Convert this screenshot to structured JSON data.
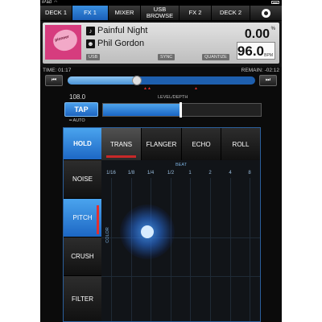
{
  "status": {
    "device": "iPad",
    "wifi_icon": "wifi-icon"
  },
  "tabs": [
    {
      "label": "DECK 1",
      "active": false
    },
    {
      "label": "FX 1",
      "active": true
    },
    {
      "label": "MIXER",
      "active": false
    },
    {
      "label": "USB BROWSE",
      "active": false
    },
    {
      "label": "FX 2",
      "active": false
    },
    {
      "label": "DECK 2",
      "active": false
    }
  ],
  "track": {
    "art_text": "pioneer",
    "title": "Painful Night",
    "artist": "Phil Gordon",
    "source": "USB",
    "sync": "SYNC",
    "quantize": "QUANTIZE",
    "pitch": "0.00",
    "pitch_unit": "%",
    "bpm": "96.0",
    "bpm_unit": "BPM"
  },
  "time": {
    "elapsed": "TIME: 01:17",
    "remain": "REMAIN: -02:12",
    "progress": 0.37
  },
  "level": {
    "label": "LEVEL/DEPTH",
    "bpm": "108.0",
    "value": 0.49
  },
  "tap": {
    "label": "TAP",
    "auto": "━ AUTO"
  },
  "fx": {
    "hold": "HOLD",
    "types": [
      "TRANS",
      "FLANGER",
      "ECHO",
      "ROLL"
    ],
    "selected_type": "TRANS",
    "side": [
      "NOISE",
      "PITCH",
      "CRUSH",
      "FILTER"
    ],
    "selected_side": "PITCH",
    "beat_label": "BEAT",
    "beats": [
      "1/16",
      "1/8",
      "1/4",
      "1/2",
      "1",
      "2",
      "4",
      "8"
    ],
    "color_label": "COLOR"
  },
  "colors": {
    "accent": "#2f86e0",
    "indicator": "#e03030"
  }
}
